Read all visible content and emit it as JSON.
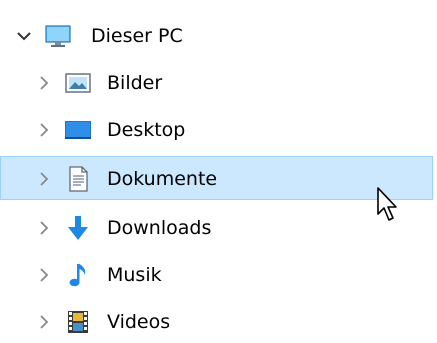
{
  "tree": {
    "root": {
      "label": "Dieser PC",
      "expanded": true,
      "icon": "monitor-icon"
    },
    "children": [
      {
        "id": "bilder",
        "label": "Bilder",
        "icon": "pictures-icon",
        "selected": false
      },
      {
        "id": "desktop",
        "label": "Desktop",
        "icon": "desktop-icon",
        "selected": false
      },
      {
        "id": "dokumente",
        "label": "Dokumente",
        "icon": "documents-icon",
        "selected": true
      },
      {
        "id": "downloads",
        "label": "Downloads",
        "icon": "download-arrow-icon",
        "selected": false
      },
      {
        "id": "musik",
        "label": "Musik",
        "icon": "music-note-icon",
        "selected": false
      },
      {
        "id": "videos",
        "label": "Videos",
        "icon": "film-icon",
        "selected": false
      }
    ]
  },
  "colors": {
    "selection_bg": "#cce8ff",
    "selection_border": "#99d1ff",
    "accent_blue": "#1e88e5"
  }
}
